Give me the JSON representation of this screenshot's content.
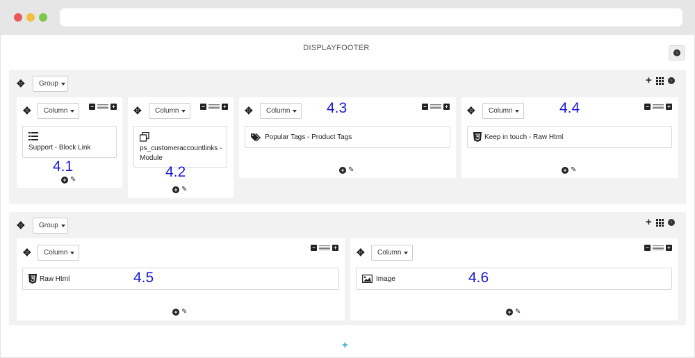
{
  "browser": {
    "url": ""
  },
  "hook": {
    "title": "DISPLAYFOOTER"
  },
  "labels": {
    "group": "Group",
    "column": "Column"
  },
  "icons": {
    "move": "move-arrows-icon",
    "add": "plus-icon",
    "grid": "grid-icon",
    "collapse": "arrow-down-circle-icon",
    "remove": "minus-square-icon",
    "list": "list-icon",
    "edit": "pencil-icon",
    "add_module": "plus-circle-icon"
  },
  "groups": [
    {
      "columns": [
        {
          "module": "Support - Block Link",
          "module_icon": "list-icon",
          "annotation": "4.1"
        },
        {
          "module": "ps_customeraccountlinks - Module",
          "module_icon": "copy-icon",
          "annotation": "4.2"
        },
        {
          "module": "Popular Tags - Product Tags",
          "module_icon": "tags-icon",
          "annotation": "4.3"
        },
        {
          "module": "Keep in touch - Raw Html",
          "module_icon": "html5-icon",
          "annotation": "4.4"
        }
      ]
    },
    {
      "columns": [
        {
          "module": "Raw Html",
          "module_icon": "html5-icon",
          "annotation": "4.5"
        },
        {
          "module": "Image",
          "module_icon": "image-icon",
          "annotation": "4.6"
        }
      ]
    }
  ],
  "add_group": "+"
}
